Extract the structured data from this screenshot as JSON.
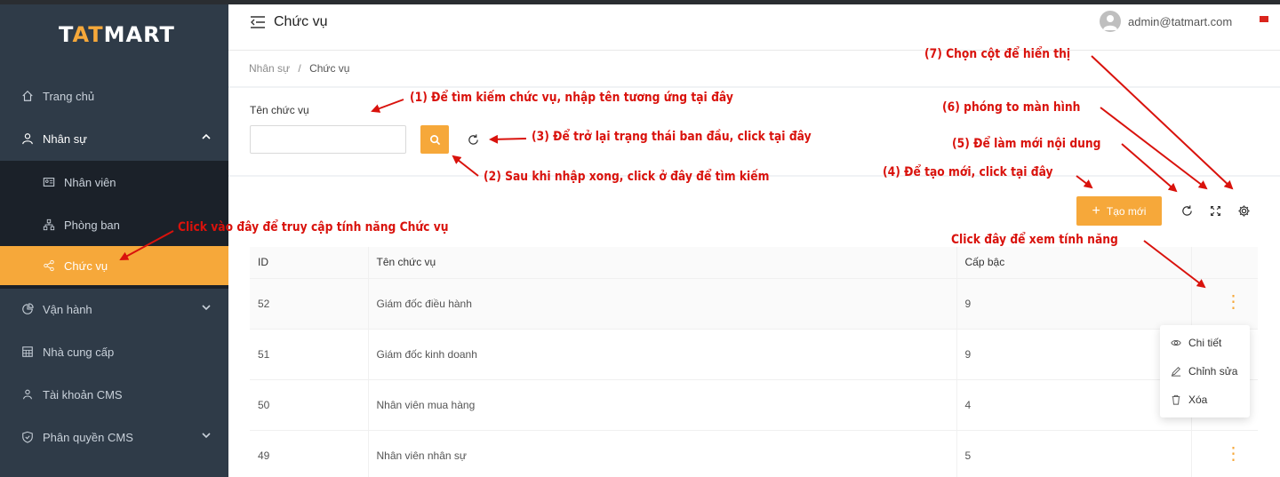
{
  "app": {
    "logo_prefix": "T",
    "logo_accent": "AT",
    "logo_suffix": "MART"
  },
  "sidebar": {
    "items": [
      {
        "label": "Trang chủ",
        "icon": "home-icon"
      },
      {
        "label": "Nhân sự",
        "icon": "user-icon"
      },
      {
        "label": "Vận hành",
        "icon": "pie-chart-icon"
      },
      {
        "label": "Nhà cung cấp",
        "icon": "building-icon"
      },
      {
        "label": "Tài khoản CMS",
        "icon": "team-icon"
      },
      {
        "label": "Phân quyền CMS",
        "icon": "safety-icon"
      }
    ],
    "submenu": [
      {
        "label": "Nhân viên",
        "icon": "id-card-icon"
      },
      {
        "label": "Phòng ban",
        "icon": "cluster-icon"
      },
      {
        "label": "Chức vụ",
        "icon": "share-icon"
      }
    ]
  },
  "header": {
    "title": "Chức vụ",
    "email": "admin@tatmart.com"
  },
  "breadcrumb": {
    "parent": "Nhân sự",
    "separator": "/",
    "current": "Chức vụ"
  },
  "filter": {
    "label": "Tên chức vụ",
    "value": "",
    "placeholder": ""
  },
  "toolbar": {
    "create_label": "Tạo mới",
    "create_plus": "+"
  },
  "table": {
    "columns": [
      "ID",
      "Tên chức vụ",
      "Cấp bậc",
      ""
    ],
    "rows": [
      {
        "id": "52",
        "name": "Giám đốc điều hành",
        "level": "9"
      },
      {
        "id": "51",
        "name": "Giám đốc kinh doanh",
        "level": "9"
      },
      {
        "id": "50",
        "name": "Nhân viên mua hàng",
        "level": "4"
      },
      {
        "id": "49",
        "name": "Nhân viên nhân sự",
        "level": "5"
      }
    ]
  },
  "row_menu": [
    {
      "label": "Chi tiết",
      "icon": "eye-icon"
    },
    {
      "label": "Chỉnh sửa",
      "icon": "edit-icon"
    },
    {
      "label": "Xóa",
      "icon": "delete-icon"
    }
  ],
  "annotations": {
    "a1": "(1) Để tìm kiếm chức vụ, nhập tên tương ứng tại đây",
    "a2": "(2)  Sau khi nhập xong, click ở đây để tìm kiếm",
    "a3": "(3) Để trở lại trạng thái ban đầu, click tại đây",
    "a4": "(4) Để tạo mới, click tại đây",
    "a5": "(5) Để làm mới nội dung",
    "a6": "(6) phóng to màn hình",
    "a7": "(7) Chọn cột để hiển thị",
    "a8": "Click vào đây để truy cập tính năng Chức vụ",
    "a9": "Click đây để xem tính năng"
  },
  "colors": {
    "accent": "#f6a83a",
    "sidebar": "#2f3b48",
    "annotation": "#d9120c"
  }
}
